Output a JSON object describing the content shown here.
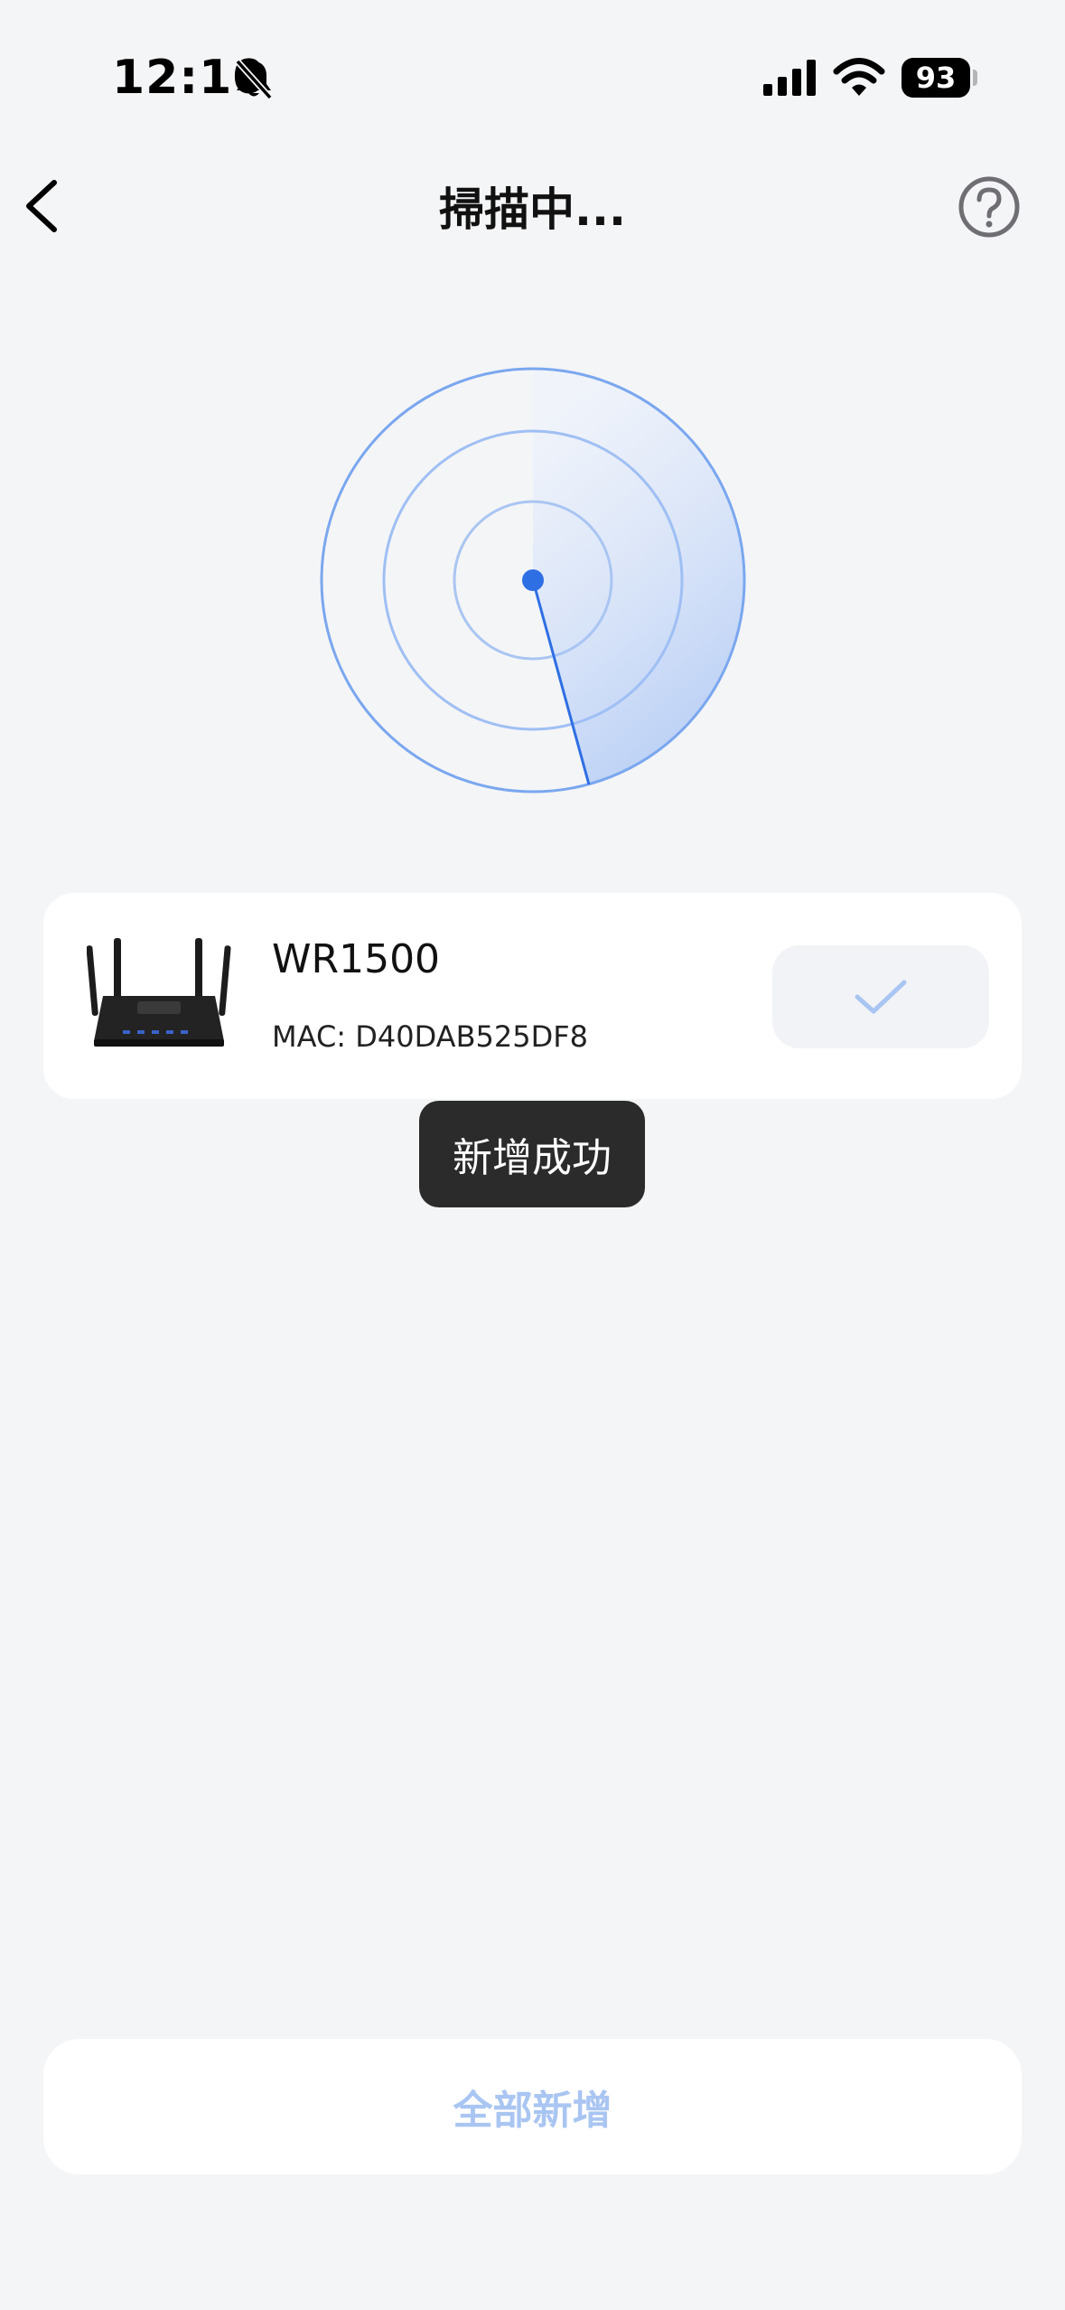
{
  "status_bar": {
    "time": "12:10",
    "battery": "93",
    "icons": [
      "bell-slash-icon",
      "cellular-signal-icon",
      "wifi-icon",
      "battery-icon"
    ]
  },
  "nav": {
    "title": "掃描中...",
    "back_icon": "chevron-left-icon",
    "help_icon": "question-circle-icon"
  },
  "radar": {
    "accent": "#2f6fe4",
    "ring_color": "#7aa7ef"
  },
  "device": {
    "name": "WR1500",
    "mac": "MAC: D40DAB525DF8",
    "status_icon": "checkmark-icon",
    "added": true
  },
  "toast": {
    "message": "新增成功"
  },
  "footer": {
    "add_all_label": "全部新增",
    "disabled_color": "#a9c5f2"
  }
}
